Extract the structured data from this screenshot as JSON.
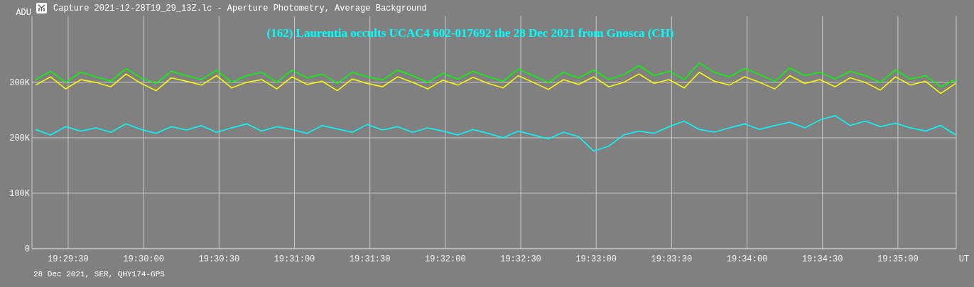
{
  "window": {
    "title": "Capture 2021-12-28T19_29_13Z.lc - Aperture Photometry, Average Background"
  },
  "chart": {
    "chart_data": {
      "type": "line",
      "title": "(162) Laurentia occults UCAC4 602-017692 the 28 Dec 2021 from Gnosca (CH)",
      "xlabel": "UT",
      "ylabel": "ADU",
      "grid": true,
      "x": [
        70157,
        70163,
        70169,
        70175,
        70181,
        70187,
        70193,
        70199,
        70205,
        70211,
        70217,
        70223,
        70229,
        70235,
        70241,
        70247,
        70253,
        70259,
        70265,
        70271,
        70277,
        70283,
        70289,
        70295,
        70301,
        70307,
        70313,
        70319,
        70325,
        70331,
        70337,
        70343,
        70349,
        70355,
        70361,
        70367,
        70373,
        70379,
        70385,
        70391,
        70397,
        70403,
        70409,
        70415,
        70421,
        70427,
        70433,
        70439,
        70445,
        70451,
        70457,
        70463,
        70469,
        70475,
        70481,
        70487,
        70493,
        70499,
        70505,
        70511,
        70517,
        70523
      ],
      "xlim": [
        70155.6,
        70523.2
      ],
      "ylim": [
        0,
        419000
      ],
      "xticks": [
        {
          "value": 70170,
          "label": "19:29:30"
        },
        {
          "value": 70200,
          "label": "19:30:00"
        },
        {
          "value": 70230,
          "label": "19:30:30"
        },
        {
          "value": 70260,
          "label": "19:31:00"
        },
        {
          "value": 70290,
          "label": "19:31:30"
        },
        {
          "value": 70320,
          "label": "19:32:00"
        },
        {
          "value": 70350,
          "label": "19:32:30"
        },
        {
          "value": 70380,
          "label": "19:33:00"
        },
        {
          "value": 70410,
          "label": "19:33:30"
        },
        {
          "value": 70440,
          "label": "19:34:00"
        },
        {
          "value": 70470,
          "label": "19:34:30"
        },
        {
          "value": 70500,
          "label": "19:35:00"
        }
      ],
      "yticks": [
        {
          "value": 0,
          "label": "0"
        },
        {
          "value": 100000,
          "label": "100K"
        },
        {
          "value": 200000,
          "label": "200K"
        },
        {
          "value": 300000,
          "label": "300K"
        }
      ],
      "series": [
        {
          "color": "#ffff00",
          "values": [
            295000,
            310000,
            288000,
            305000,
            300000,
            292000,
            315000,
            298000,
            285000,
            308000,
            302000,
            295000,
            312000,
            290000,
            300000,
            305000,
            288000,
            310000,
            296000,
            302000,
            285000,
            306000,
            298000,
            292000,
            310000,
            300000,
            288000,
            304000,
            295000,
            309000,
            298000,
            290000,
            312000,
            300000,
            287000,
            305000,
            296000,
            310000,
            292000,
            300000,
            315000,
            298000,
            305000,
            290000,
            318000,
            302000,
            295000,
            310000,
            300000,
            288000,
            312000,
            298000,
            305000,
            292000,
            308000,
            300000,
            286000,
            310000,
            295000,
            302000,
            280000,
            298000
          ]
        },
        {
          "color": "#00ff00",
          "values": [
            305000,
            320000,
            300000,
            318000,
            310000,
            302000,
            325000,
            308000,
            298000,
            320000,
            312000,
            305000,
            322000,
            300000,
            312000,
            318000,
            300000,
            322000,
            308000,
            315000,
            298000,
            318000,
            310000,
            304000,
            322000,
            312000,
            300000,
            316000,
            306000,
            320000,
            310000,
            302000,
            324000,
            312000,
            300000,
            318000,
            308000,
            322000,
            305000,
            314000,
            330000,
            312000,
            320000,
            305000,
            335000,
            318000,
            310000,
            325000,
            314000,
            302000,
            326000,
            312000,
            318000,
            306000,
            320000,
            312000,
            300000,
            322000,
            306000,
            312000,
            292000,
            305000
          ]
        },
        {
          "color": "#00ffff",
          "values": [
            215000,
            205000,
            220000,
            212000,
            218000,
            210000,
            225000,
            215000,
            208000,
            220000,
            214000,
            222000,
            210000,
            218000,
            225000,
            212000,
            220000,
            215000,
            208000,
            222000,
            216000,
            210000,
            224000,
            214000,
            220000,
            210000,
            218000,
            212000,
            205000,
            215000,
            208000,
            200000,
            212000,
            205000,
            198000,
            210000,
            202000,
            176000,
            185000,
            205000,
            212000,
            208000,
            220000,
            230000,
            215000,
            210000,
            218000,
            225000,
            215000,
            222000,
            228000,
            218000,
            232000,
            240000,
            222000,
            230000,
            220000,
            226000,
            218000,
            212000,
            222000,
            205000
          ]
        }
      ]
    }
  },
  "footer": "28 Dec 2021, SER, QHY174-GPS"
}
